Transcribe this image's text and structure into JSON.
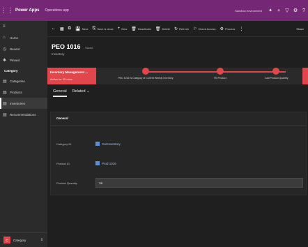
{
  "topbar": {
    "waffle": "⋮⋮",
    "brand": "Power Apps",
    "app_name": "Operations app",
    "environment": "Sandbox environment",
    "icons": [
      "lightbulb-icon",
      "plus-icon",
      "filter-icon",
      "gear-icon",
      "help-icon"
    ]
  },
  "sidebar": {
    "menu_glyph": "≡",
    "items": [
      {
        "icon": "⌂",
        "label": "Home"
      },
      {
        "icon": "◷",
        "label": "Recent"
      },
      {
        "icon": "✱",
        "label": "Pinned"
      }
    ],
    "section": "Category",
    "nav": [
      {
        "icon": "▤",
        "label": "Categories"
      },
      {
        "icon": "▤",
        "label": "Products"
      },
      {
        "icon": "▤",
        "label": "Inventories",
        "active": true
      },
      {
        "icon": "▤",
        "label": "Recommendations"
      }
    ],
    "area_badge": "C",
    "area_label": "Category",
    "area_chevron": "⇕"
  },
  "commandbar": {
    "commands": [
      {
        "icon": "←",
        "label": ""
      },
      {
        "icon": "▦",
        "label": ""
      },
      {
        "icon": "⧉",
        "label": ""
      },
      {
        "icon": "💾",
        "label": "Save"
      },
      {
        "icon": "⎘",
        "label": "Save & close"
      },
      {
        "icon": "+",
        "label": "New"
      },
      {
        "icon": "🗑",
        "label": "Deactivate"
      },
      {
        "icon": "🗑",
        "label": "Delete"
      },
      {
        "icon": "↻",
        "label": "Refresh"
      },
      {
        "icon": "⚐",
        "label": "Check Access"
      },
      {
        "icon": "⚙",
        "label": "Process"
      },
      {
        "icon": "⋮",
        "label": ""
      }
    ],
    "share": "Share"
  },
  "record": {
    "title": "PEO 1016",
    "saved": "- Saved",
    "subtitle": "Inventory"
  },
  "bpf": {
    "active_stage": "Inventory Management ...",
    "active_sub": "Active for 25 mins",
    "stages": [
      "PEO 1016 Is Category of Current Weekly Inventory",
      "Fill Product",
      "Add Product Quantity"
    ]
  },
  "tabs": [
    {
      "label": "General",
      "active": true
    },
    {
      "label": "Related",
      "active": false
    }
  ],
  "form": {
    "section_title": "General",
    "fields": [
      {
        "label": "Category ID",
        "value": "Cat Inventory",
        "type": "lookup"
      },
      {
        "label": "Product ID",
        "value": "Prod 1016",
        "type": "lookup"
      },
      {
        "label": "Product Quantity",
        "value": "16",
        "type": "input"
      }
    ]
  },
  "colors": {
    "accent": "#742774",
    "stage": "#e0464b",
    "background": "#1f1f1f"
  }
}
